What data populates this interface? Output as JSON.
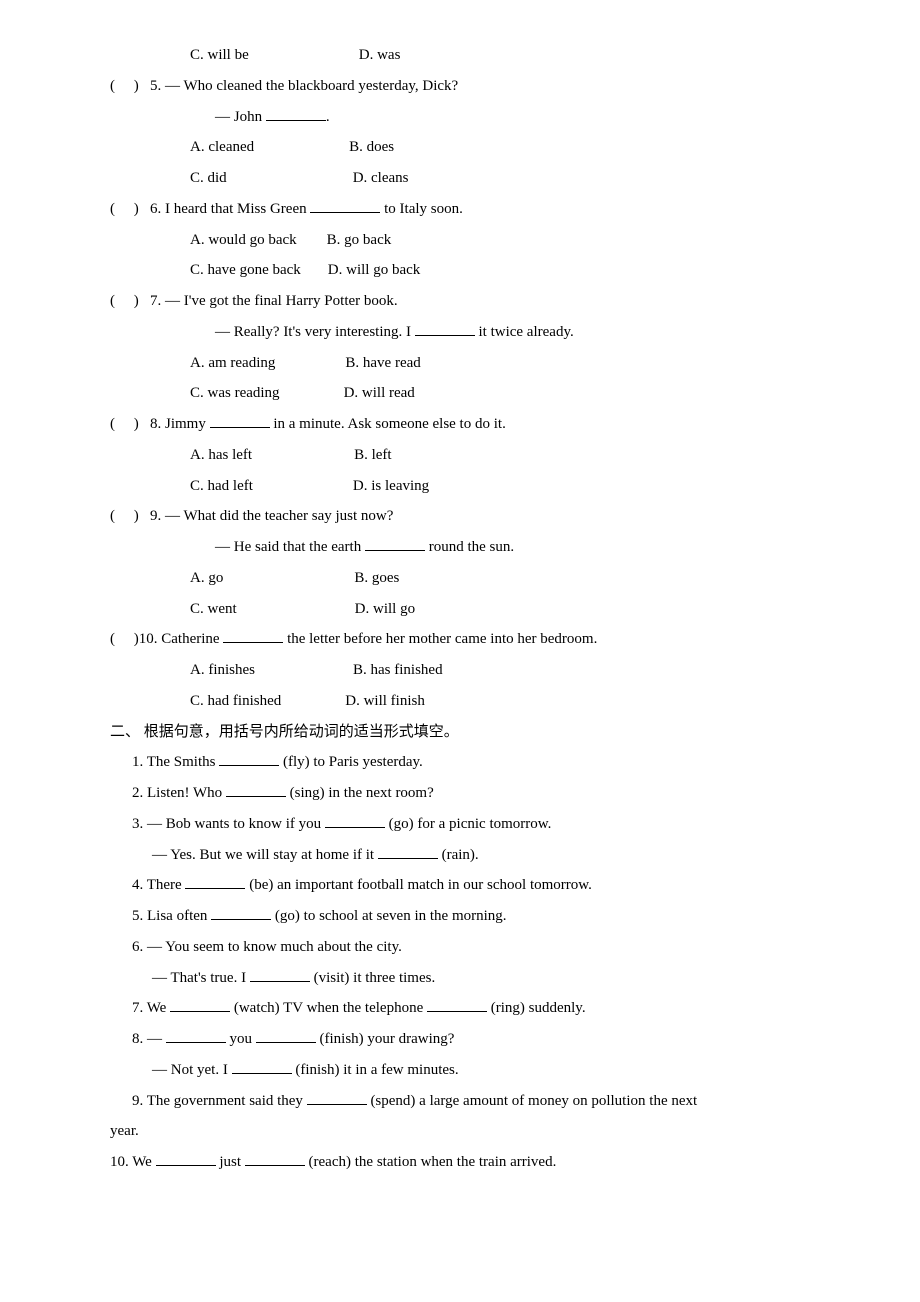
{
  "q5": {
    "optC": "C. will be",
    "optD": "D. was",
    "prompt_pre": "(     )   5. — Who cleaned the blackboard yesterday, Dick?",
    "dash_john_pre": "— John ",
    "dot": ".",
    "optA": "A. cleaned",
    "optB": "B. does",
    "optC2": "C. did",
    "optD2": "D. cleans"
  },
  "q6": {
    "prompt_pre": "(     )   6. I heard that Miss Green ",
    "prompt_post": " to Italy soon.",
    "optA": "A. would go back",
    "optB": "B. go back",
    "optC": "C. have gone back",
    "optD": "D. will go back"
  },
  "q7": {
    "prompt": "(     )   7. — I've got the final Harry Potter book.",
    "dash_pre": "— Really? It's very interesting. I ",
    "dash_post": " it twice already.",
    "optA": "A. am reading",
    "optB": "B. have read",
    "optC": "C. was reading",
    "optD": "D. will read"
  },
  "q8": {
    "prompt_pre": "(     )   8. Jimmy ",
    "prompt_post": " in a minute. Ask someone else to do it.",
    "optA": "A. has left",
    "optB": "B. left",
    "optC": "C. had left",
    "optD": "D. is leaving"
  },
  "q9": {
    "prompt": "(     )   9. — What did the teacher say just now?",
    "dash_pre": "— He said that the earth ",
    "dash_post": " round the sun.",
    "optA": "A. go",
    "optB": "B. goes",
    "optC": "C. went",
    "optD": "D. will go"
  },
  "q10": {
    "prompt_pre": "(     )10. Catherine ",
    "prompt_post": " the letter before her mother came into her bedroom.",
    "optA": "A. finishes",
    "optB": "B. has finished",
    "optC": "C. had finished",
    "optD": "D. will finish"
  },
  "section2": "二、 根据句意，用括号内所给动词的适当形式填空。",
  "s2q1_pre": "1. The Smiths ",
  "s2q1_post": " (fly) to Paris yesterday.",
  "s2q2_pre": "2. Listen! Who ",
  "s2q2_post": " (sing) in the next room?",
  "s2q3_pre": "3. — Bob wants to know if you ",
  "s2q3_post": " (go) for a picnic tomorrow.",
  "s2q3b_pre": "— Yes. But we will stay at home if it ",
  "s2q3b_post": " (rain).",
  "s2q4_pre": "4. There ",
  "s2q4_post": " (be) an important football match in our school tomorrow.",
  "s2q5_pre": "5. Lisa often ",
  "s2q5_post": " (go) to school at seven in the morning.",
  "s2q6": "6. — You seem to know much about the city.",
  "s2q6b_pre": "— That's true. I ",
  "s2q6b_post": " (visit) it three times.",
  "s2q7_pre": "7. We ",
  "s2q7_mid": " (watch) TV when the telephone ",
  "s2q7_post": " (ring) suddenly.",
  "s2q8_pre": "8. — ",
  "s2q8_mid": " you ",
  "s2q8_post": " (finish) your drawing?",
  "s2q8b_pre": "— Not yet. I ",
  "s2q8b_post": " (finish) it in a few minutes.",
  "s2q9_pre": "9. The government said they ",
  "s2q9_post": " (spend) a large amount of money on pollution the next",
  "s2q9_line2": "year.",
  "s2q10_pre": "10. We ",
  "s2q10_mid": " just ",
  "s2q10_post": " (reach) the station when the train arrived."
}
